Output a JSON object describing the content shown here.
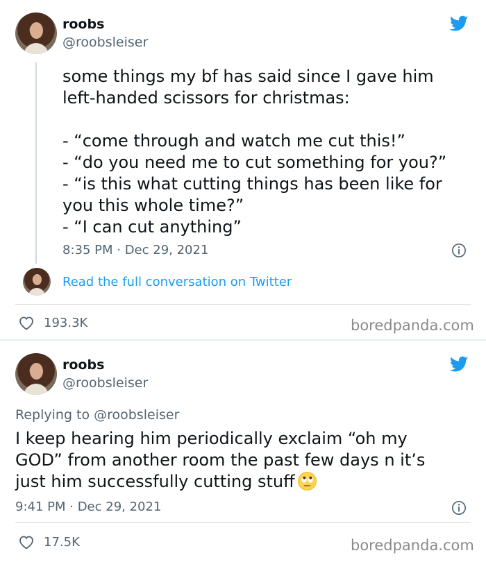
{
  "tweets": [
    {
      "author_name": "roobs",
      "author_handle": "@roobsleiser",
      "text": "some things my bf has said since I gave him\nleft-handed scissors for christmas:\n\n- “come through and watch me cut this!”\n- “do you need me to cut something for you?”\n- “is this what cutting things has been like for\nyou this whole time?”\n- “I can cut anything”",
      "timestamp": "8:35 PM · Dec 29, 2021",
      "link_text": "Read the full conversation on Twitter",
      "likes": "193.3K",
      "watermark": "boredpanda.com"
    },
    {
      "author_name": "roobs",
      "author_handle": "@roobsleiser",
      "replying_to": "Replying to @roobsleiser",
      "text": "I keep hearing him periodically exclaim “oh my\nGOD” from another room the past few days n it’s\njust him successfully cutting stuff",
      "emoji": "face-with-rolling-eyes",
      "timestamp": "9:41 PM · Dec 29, 2021",
      "likes": "17.5K",
      "watermark": "boredpanda.com"
    }
  ],
  "colors": {
    "twitter_blue": "#1d9bf0",
    "secondary_text": "#536471",
    "watermark": "#8a8a8a"
  },
  "icons": [
    "twitter-bird-icon",
    "info-icon",
    "heart-icon",
    "avatar"
  ]
}
